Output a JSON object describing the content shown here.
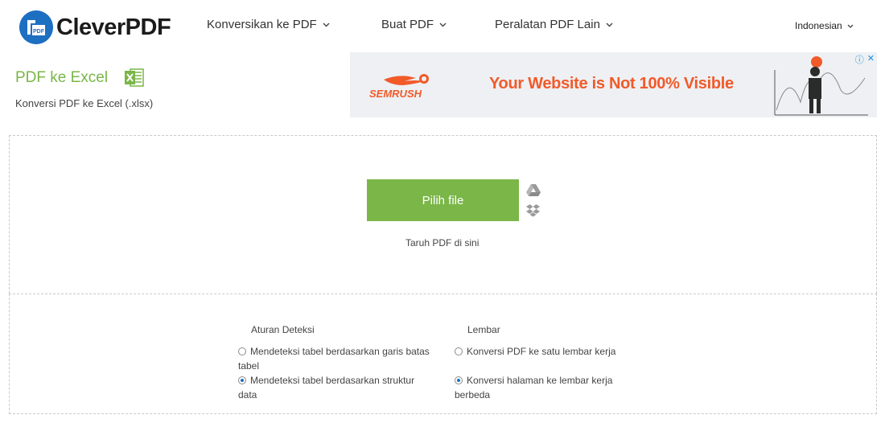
{
  "header": {
    "logo_text": "CleverPDF",
    "logo_badge": "PDF",
    "nav": [
      {
        "label": "Konversikan ke PDF"
      },
      {
        "label": "Buat PDF"
      },
      {
        "label": "Peralatan PDF Lain"
      }
    ],
    "language": "Indonesian"
  },
  "tool": {
    "title": "PDF ke Excel",
    "icon": "excel-icon",
    "subtitle": "Konversi PDF ke Excel (.xlsx)"
  },
  "ad": {
    "brand": "SEMRUSH",
    "headline": "Your Website is Not 100% Visible",
    "info_icon": "ⓘ",
    "close_icon": "✕"
  },
  "upload": {
    "button_label": "Pilih file",
    "drop_hint": "Taruh PDF di sini",
    "cloud_icons": [
      "google-drive-icon",
      "dropbox-icon"
    ]
  },
  "options": {
    "detection": {
      "heading": "Aturan Deteksi",
      "items": [
        {
          "label": "Mendeteksi tabel berdasarkan garis batas tabel",
          "checked": false
        },
        {
          "label": "Mendeteksi tabel berdasarkan struktur data",
          "checked": true
        }
      ]
    },
    "sheet": {
      "heading": "Lembar",
      "items": [
        {
          "label": "Konversi PDF ke satu lembar kerja",
          "checked": false
        },
        {
          "label": "Konversi halaman ke lembar kerja berbeda",
          "checked": true
        }
      ]
    }
  },
  "colors": {
    "accent_green": "#7ab648",
    "brand_blue": "#1d6fc2",
    "ad_orange": "#f15a29"
  }
}
